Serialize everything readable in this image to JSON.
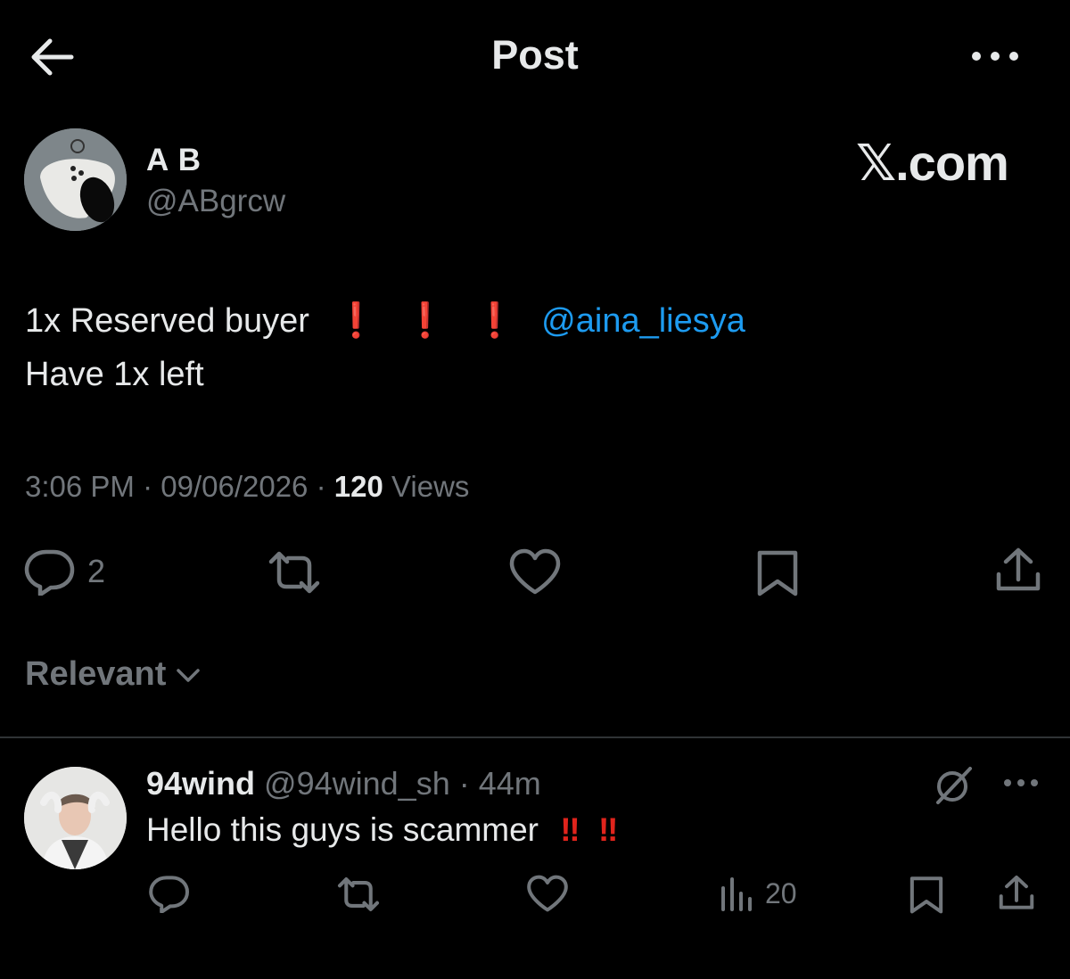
{
  "header": {
    "title": "Post"
  },
  "watermark": "𝕏.com",
  "post": {
    "author_name": "A B",
    "author_handle": "@ABgrcw",
    "text_line1": "1x Reserved buyer",
    "exclamations": [
      "❗",
      "❗",
      "❗"
    ],
    "mention": "@aina_liesya",
    "text_line2": "Have 1x left",
    "time": "3:06 PM",
    "date": "09/06/2026",
    "views_count": "120",
    "views_label": "Views",
    "reply_count": "2"
  },
  "sort": {
    "label": "Relevant"
  },
  "reply": {
    "name": "94wind",
    "handle": "@94wind_sh",
    "time": "44m",
    "text": "Hello this guys is scammer",
    "exclamations": [
      "‼",
      "‼"
    ],
    "views_count": "20"
  },
  "colors": {
    "background": "#000000",
    "text": "#e7e9ea",
    "secondary": "#71767b",
    "link": "#1d9bf0",
    "alert": "#e0241c"
  },
  "icons": [
    "back-arrow-icon",
    "more-icon",
    "reply-icon",
    "repost-icon",
    "like-icon",
    "bookmark-icon",
    "share-icon",
    "chevron-down-icon",
    "grok-icon",
    "views-icon"
  ]
}
